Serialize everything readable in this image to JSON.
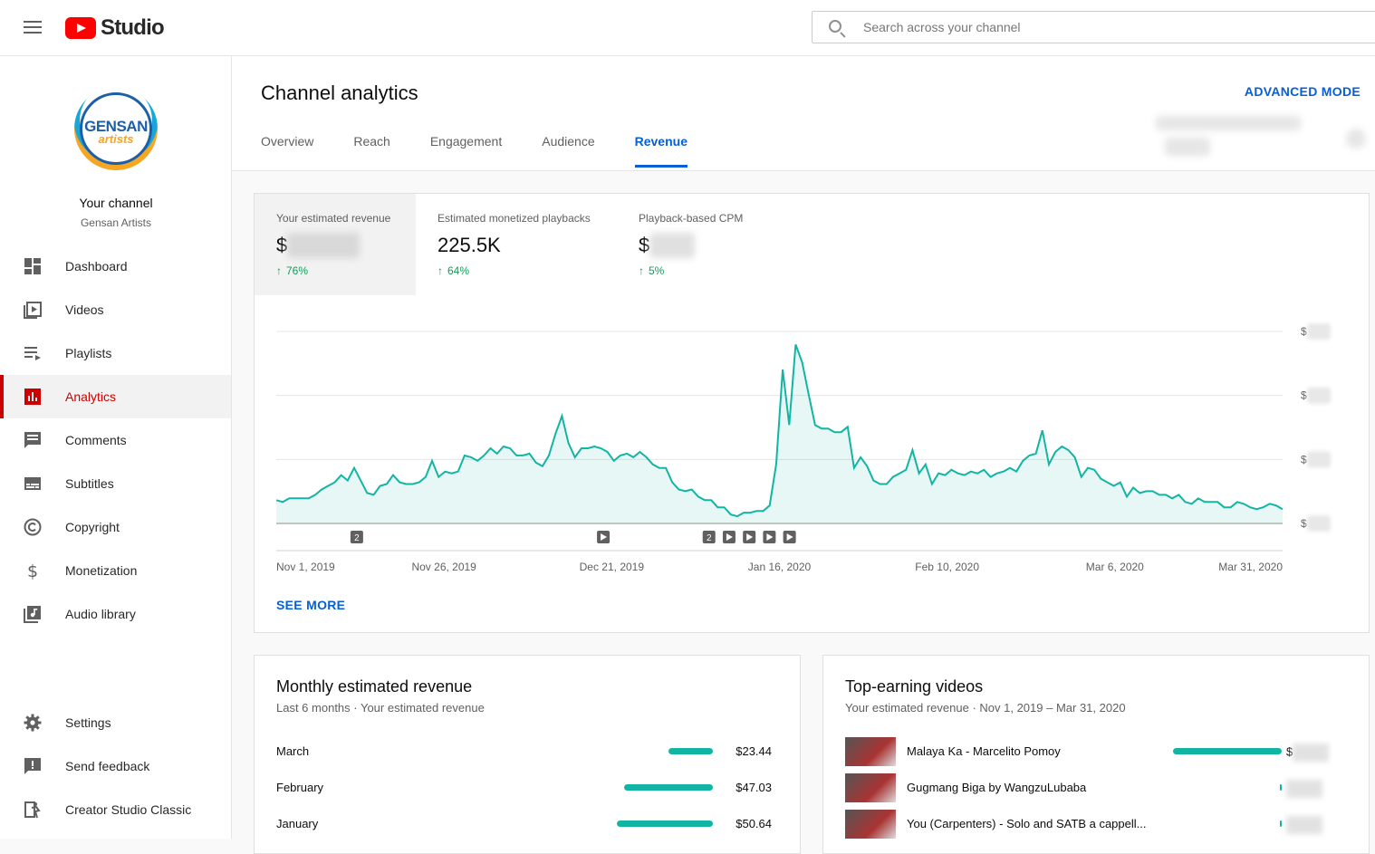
{
  "app": {
    "brand": "Studio"
  },
  "search": {
    "placeholder": "Search across your channel"
  },
  "channel": {
    "title": "Your channel",
    "name": "Gensan Artists",
    "logo_text_1": "GENSAN",
    "logo_text_2": "artists"
  },
  "nav": [
    {
      "label": "Dashboard",
      "icon": "dashboard-icon"
    },
    {
      "label": "Videos",
      "icon": "videos-icon"
    },
    {
      "label": "Playlists",
      "icon": "playlists-icon"
    },
    {
      "label": "Analytics",
      "icon": "analytics-icon",
      "active": true
    },
    {
      "label": "Comments",
      "icon": "comments-icon"
    },
    {
      "label": "Subtitles",
      "icon": "subtitles-icon"
    },
    {
      "label": "Copyright",
      "icon": "copyright-icon"
    },
    {
      "label": "Monetization",
      "icon": "monetization-icon"
    },
    {
      "label": "Audio library",
      "icon": "audio-library-icon"
    }
  ],
  "nav_bottom": [
    {
      "label": "Settings",
      "icon": "settings-icon"
    },
    {
      "label": "Send feedback",
      "icon": "feedback-icon"
    },
    {
      "label": "Creator Studio Classic",
      "icon": "creator-studio-classic-icon"
    }
  ],
  "page": {
    "title": "Channel analytics",
    "advanced_mode": "ADVANCED MODE"
  },
  "tabs": [
    "Overview",
    "Reach",
    "Engagement",
    "Audience",
    "Revenue"
  ],
  "active_tab": "Revenue",
  "metrics": [
    {
      "label": "Your estimated revenue",
      "value_prefix": "$",
      "change": "76%",
      "direction": "up"
    },
    {
      "label": "Estimated monetized playbacks",
      "value": "225.5K",
      "change": "64%",
      "direction": "up"
    },
    {
      "label": "Playback-based CPM",
      "value_prefix": "$",
      "change": "5%",
      "direction": "up"
    }
  ],
  "colors": {
    "accent": "#065fd4",
    "series": "#12b5a3",
    "brand_red": "#ff0000",
    "active_nav": "#cc0000",
    "positive": "#0f9d58"
  },
  "chart_data": {
    "type": "area",
    "title": "",
    "x_tick_labels": [
      "Nov 1, 2019",
      "Nov 26, 2019",
      "Dec 21, 2019",
      "Jan 16, 2020",
      "Feb 10, 2020",
      "Mar 6, 2020",
      "Mar 31, 2020"
    ],
    "x_start": "2019-11-01",
    "x_end": "2020-03-31",
    "y_tick_prefix": "$",
    "y_ticks_count": 4,
    "grid": true,
    "series": [
      {
        "values": [
          0.13,
          0.12,
          0.14,
          0.14,
          0.14,
          0.14,
          0.16,
          0.19,
          0.21,
          0.23,
          0.27,
          0.24,
          0.31,
          0.24,
          0.17,
          0.16,
          0.21,
          0.22,
          0.27,
          0.23,
          0.22,
          0.22,
          0.23,
          0.26,
          0.35,
          0.26,
          0.29,
          0.28,
          0.29,
          0.38,
          0.37,
          0.35,
          0.38,
          0.42,
          0.39,
          0.43,
          0.42,
          0.38,
          0.38,
          0.39,
          0.34,
          0.32,
          0.38,
          0.5,
          0.6,
          0.45,
          0.37,
          0.42,
          0.42,
          0.43,
          0.42,
          0.4,
          0.35,
          0.38,
          0.39,
          0.37,
          0.4,
          0.37,
          0.33,
          0.31,
          0.31,
          0.23,
          0.19,
          0.18,
          0.19,
          0.15,
          0.13,
          0.13,
          0.09,
          0.09,
          0.05,
          0.04,
          0.06,
          0.06,
          0.07,
          0.07,
          0.1,
          0.33,
          0.86,
          0.55,
          1.0,
          0.9,
          0.72,
          0.55,
          0.53,
          0.53,
          0.51,
          0.51,
          0.54,
          0.31,
          0.37,
          0.32,
          0.24,
          0.22,
          0.22,
          0.26,
          0.28,
          0.3,
          0.41,
          0.28,
          0.33,
          0.22,
          0.28,
          0.27,
          0.3,
          0.28,
          0.27,
          0.29,
          0.28,
          0.3,
          0.26,
          0.28,
          0.29,
          0.31,
          0.29,
          0.35,
          0.38,
          0.39,
          0.52,
          0.33,
          0.4,
          0.43,
          0.41,
          0.37,
          0.26,
          0.31,
          0.3,
          0.25,
          0.23,
          0.21,
          0.23,
          0.15,
          0.2,
          0.17,
          0.18,
          0.18,
          0.16,
          0.16,
          0.14,
          0.16,
          0.12,
          0.11,
          0.14,
          0.12,
          0.12,
          0.12,
          0.09,
          0.09,
          0.12,
          0.11,
          0.09,
          0.08,
          0.09,
          0.11,
          0.1,
          0.08
        ]
      }
    ],
    "event_markers": [
      {
        "kind": "count",
        "label": "2",
        "position": 0.08
      },
      {
        "kind": "video",
        "label": "",
        "position": 0.325
      },
      {
        "kind": "count",
        "label": "2",
        "position": 0.43
      },
      {
        "kind": "video",
        "label": "",
        "position": 0.45
      },
      {
        "kind": "video",
        "label": "",
        "position": 0.47
      },
      {
        "kind": "video",
        "label": "",
        "position": 0.49
      },
      {
        "kind": "video",
        "label": "",
        "position": 0.51
      }
    ],
    "see_more": "SEE MORE"
  },
  "monthly": {
    "title": "Monthly estimated revenue",
    "caption": "Last 6 months · Your estimated revenue",
    "rows": [
      {
        "label": "March",
        "amount": "$23.44",
        "value": 23.44
      },
      {
        "label": "February",
        "amount": "$47.03",
        "value": 47.03
      },
      {
        "label": "January",
        "amount": "$50.64",
        "value": 50.64
      }
    ],
    "max": 50.64
  },
  "top_videos": {
    "title": "Top-earning videos",
    "caption": "Your estimated revenue · Nov 1, 2019 – Mar 31, 2020",
    "rows": [
      {
        "title": "Malaya Ka - Marcelito Pomoy",
        "amount_prefix": "$",
        "share": 1.0
      },
      {
        "title": "Gugmang Biga by WangzuLubaba",
        "amount_prefix": "",
        "share": 0.02
      },
      {
        "title": "You (Carpenters) - Solo and SATB a cappell...",
        "amount_prefix": "",
        "share": 0.02
      }
    ]
  }
}
